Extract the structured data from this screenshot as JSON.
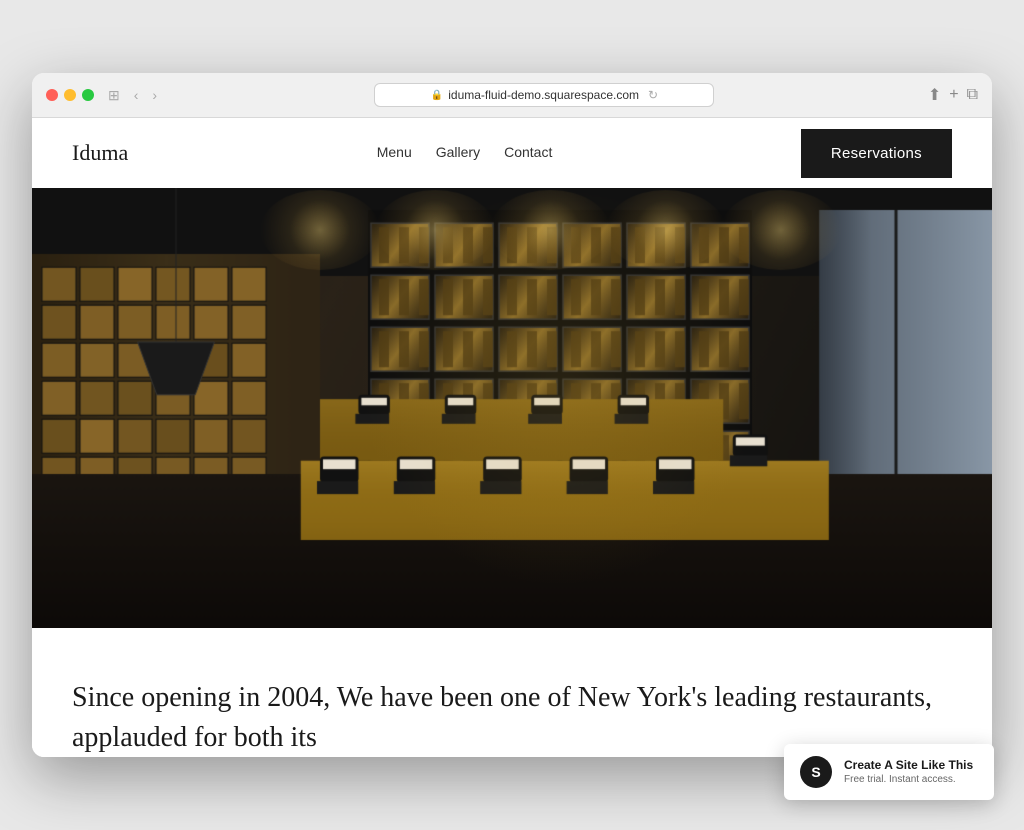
{
  "browser": {
    "url": "iduma-fluid-demo.squarespace.com",
    "back_icon": "‹",
    "forward_icon": "›",
    "window_icon": "⊞",
    "refresh_icon": "↻",
    "share_icon": "⬆",
    "add_tab_icon": "+",
    "copy_icon": "⧉"
  },
  "site": {
    "logo": "Iduma",
    "nav": {
      "links": [
        {
          "label": "Menu",
          "href": "#"
        },
        {
          "label": "Gallery",
          "href": "#"
        },
        {
          "label": "Contact",
          "href": "#"
        }
      ],
      "cta_label": "Reservations"
    },
    "hero_alt": "Restaurant interior with wooden tables and wine storage wall",
    "body_text": "Since opening in 2004, We have been one of New York's leading restaurants, applauded for both its"
  },
  "squarespace_badge": {
    "logo_text": "S",
    "title": "Create A Site Like This",
    "subtitle": "Free trial. Instant access."
  }
}
